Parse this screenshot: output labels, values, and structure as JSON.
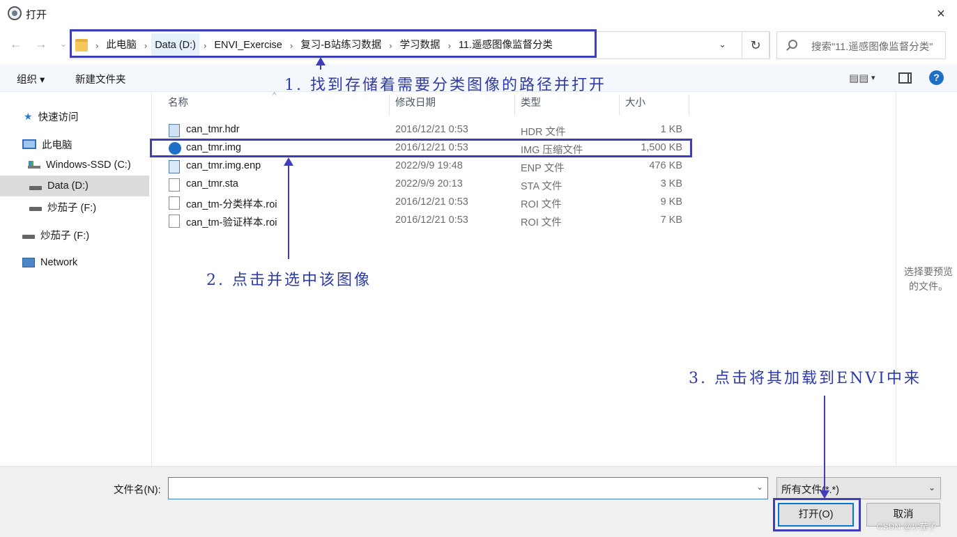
{
  "window": {
    "title": "打开",
    "close_icon": "×"
  },
  "nav": {
    "back_icon": "←",
    "forward_icon": "→",
    "recent_icon": "⌄"
  },
  "address": {
    "crumbs": [
      "此电脑",
      "Data (D:)",
      "ENVI_Exercise",
      "复习-B站练习数据",
      "学习数据",
      "11.遥感图像监督分类"
    ],
    "separator": "›",
    "refresh_icon": "↻",
    "dropdown_icon": "⌄"
  },
  "search": {
    "placeholder": "搜索\"11.遥感图像监督分类\""
  },
  "toolbar": {
    "organize": "组织 ▾",
    "new_folder": "新建文件夹",
    "view_icon": "▤▤",
    "view_caret": "▾",
    "help": "?"
  },
  "sidebar": {
    "quick_access": "快速访问",
    "this_pc": "此电脑",
    "drives": [
      "Windows-SSD (C:)",
      "Data (D:)",
      "炒茄子 (F:)"
    ],
    "extra_drive": "炒茄子 (F:)",
    "network": "Network"
  },
  "columns": {
    "name": "名称",
    "modified": "修改日期",
    "type": "类型",
    "size": "大小",
    "sort_icon": "^"
  },
  "files": [
    {
      "name": "can_tmr.hdr",
      "date": "2016/12/21 0:53",
      "type": "HDR 文件",
      "size": "1 KB",
      "icon": "hdr-file-icon"
    },
    {
      "name": "can_tmr.img",
      "date": "2016/12/21 0:53",
      "type": "IMG 压缩文件",
      "size": "1,500 KB",
      "icon": "img-file-icon"
    },
    {
      "name": "can_tmr.img.enp",
      "date": "2022/9/9 19:48",
      "type": "ENP 文件",
      "size": "476 KB",
      "icon": "enp-file-icon"
    },
    {
      "name": "can_tmr.sta",
      "date": "2022/9/9 20:13",
      "type": "STA 文件",
      "size": "3 KB",
      "icon": "file-icon"
    },
    {
      "name": "can_tm-分类样本.roi",
      "date": "2016/12/21 0:53",
      "type": "ROI 文件",
      "size": "9 KB",
      "icon": "file-icon"
    },
    {
      "name": "can_tm-验证样本.roi",
      "date": "2016/12/21 0:53",
      "type": "ROI 文件",
      "size": "7 KB",
      "icon": "file-icon"
    }
  ],
  "preview": {
    "empty_text": "选择要预览的文件。"
  },
  "footer": {
    "filename_label": "文件名(N):",
    "filename_value": "",
    "filter_value": "所有文件(*.*)",
    "caret_icon": "⌄",
    "open_button": "打开(O)",
    "cancel_button": "取消",
    "watermark": "CSDN @炒茄子"
  },
  "annotations": {
    "step1": "1. 找到存储着需要分类图像的路径并打开",
    "step2": "2. 点击并选中该图像",
    "step3": "3. 点击将其加载到ENVI中来",
    "color": "#3e3eb8"
  }
}
